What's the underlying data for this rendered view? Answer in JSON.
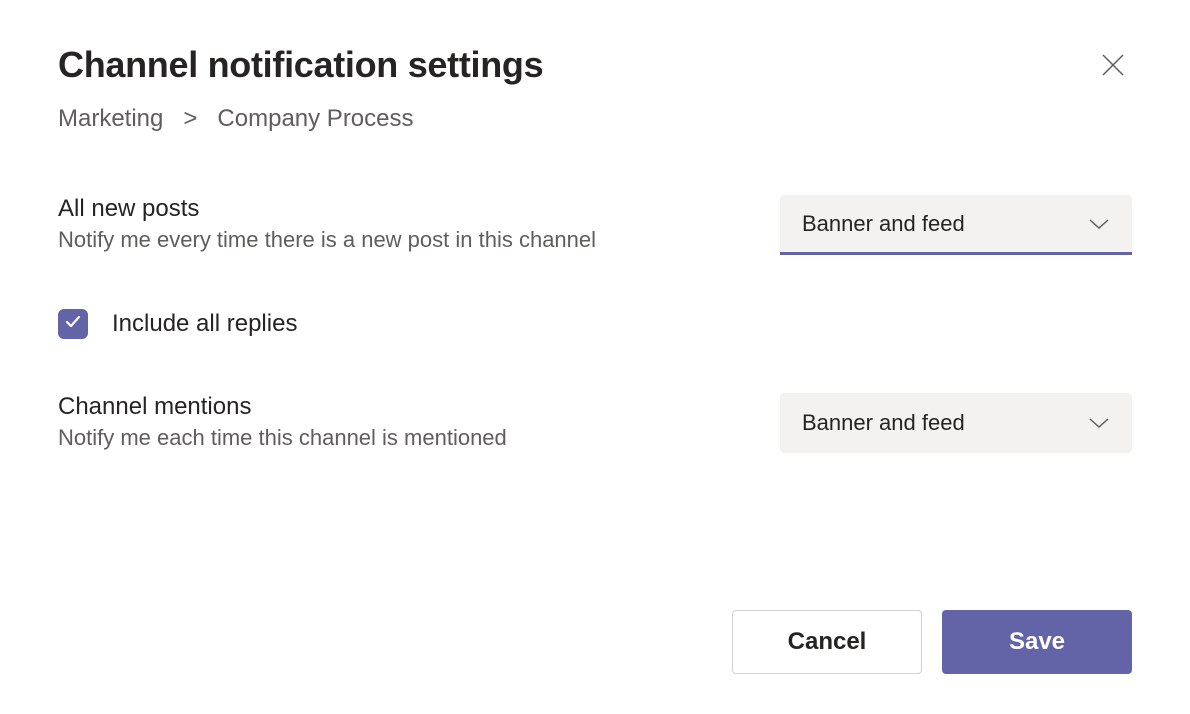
{
  "dialog": {
    "title": "Channel notification settings",
    "breadcrumb": {
      "team": "Marketing",
      "separator": ">",
      "channel": "Company Process"
    }
  },
  "settings": {
    "all_new_posts": {
      "label": "All new posts",
      "description": "Notify me every time there is a new post in this channel",
      "dropdown_value": "Banner and feed"
    },
    "include_replies": {
      "checked": true,
      "label": "Include all replies"
    },
    "channel_mentions": {
      "label": "Channel mentions",
      "description": "Notify me each time this channel is mentioned",
      "dropdown_value": "Banner and feed"
    }
  },
  "footer": {
    "cancel_label": "Cancel",
    "save_label": "Save"
  },
  "colors": {
    "accent": "#6264a7",
    "text_secondary": "#605e5c",
    "surface_light": "#f3f2f1"
  }
}
